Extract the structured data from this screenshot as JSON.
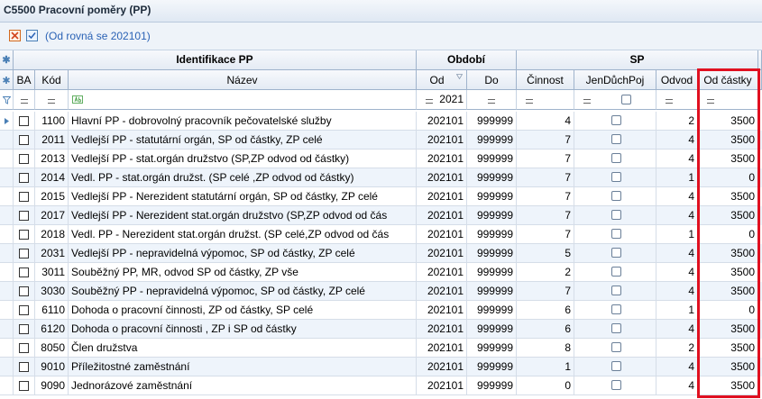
{
  "window": {
    "title": "C5500 Pracovní poměry (PP)"
  },
  "filter": {
    "text": "(Od rovná se 202101)"
  },
  "groups": {
    "ident": "Identifikace PP",
    "period": "Období",
    "sp": "SP"
  },
  "columns": {
    "ba": "BA",
    "kod": "Kód",
    "nazev": "Název",
    "od": "Od",
    "do": "Do",
    "cinnost": "Činnost",
    "jendp": "JenDůchPoj",
    "odvod": "Odvod",
    "odcastky": "Od částky"
  },
  "filter_row": {
    "od_value": "2021"
  },
  "rows": [
    {
      "kod": "1100",
      "nazev": "Hlavní PP - dobrovolný pracovník pečovatelské služby",
      "od": "202101",
      "do": "999999",
      "cinnost": "4",
      "odvod": "2",
      "odcastky": "3500"
    },
    {
      "kod": "2011",
      "nazev": "Vedlejší PP - statutární orgán, SP od částky, ZP celé",
      "od": "202101",
      "do": "999999",
      "cinnost": "7",
      "odvod": "4",
      "odcastky": "3500"
    },
    {
      "kod": "2013",
      "nazev": "Vedlejší PP - stat.orgán družstvo (SP,ZP  odvod od částky)",
      "od": "202101",
      "do": "999999",
      "cinnost": "7",
      "odvod": "4",
      "odcastky": "3500"
    },
    {
      "kod": "2014",
      "nazev": "Vedl. PP - stat.orgán družst. (SP celé ,ZP  odvod od částky)",
      "od": "202101",
      "do": "999999",
      "cinnost": "7",
      "odvod": "1",
      "odcastky": "0"
    },
    {
      "kod": "2015",
      "nazev": "Vedlejší PP - Nerezident statutární orgán, SP od částky, ZP celé",
      "od": "202101",
      "do": "999999",
      "cinnost": "7",
      "odvod": "4",
      "odcastky": "3500"
    },
    {
      "kod": "2017",
      "nazev": "Vedlejší PP - Nerezident stat.orgán družstvo (SP,ZP  odvod od čás",
      "od": "202101",
      "do": "999999",
      "cinnost": "7",
      "odvod": "4",
      "odcastky": "3500"
    },
    {
      "kod": "2018",
      "nazev": "Vedl. PP - Nerezident stat.orgán družst. (SP celé,ZP  odvod od čás",
      "od": "202101",
      "do": "999999",
      "cinnost": "7",
      "odvod": "1",
      "odcastky": "0"
    },
    {
      "kod": "2031",
      "nazev": "Vedlejší PP - nepravidelná výpomoc, SP od částky, ZP celé",
      "od": "202101",
      "do": "999999",
      "cinnost": "5",
      "odvod": "4",
      "odcastky": "3500"
    },
    {
      "kod": "3011",
      "nazev": "Souběžný PP, MR, odvod SP od částky, ZP vše",
      "od": "202101",
      "do": "999999",
      "cinnost": "2",
      "odvod": "4",
      "odcastky": "3500"
    },
    {
      "kod": "3030",
      "nazev": "Souběžný PP - nepravidelná výpomoc, SP od částky, ZP celé",
      "od": "202101",
      "do": "999999",
      "cinnost": "7",
      "odvod": "4",
      "odcastky": "3500"
    },
    {
      "kod": "6110",
      "nazev": "Dohoda o pracovní činnosti, ZP od částky, SP celé",
      "od": "202101",
      "do": "999999",
      "cinnost": "6",
      "odvod": "1",
      "odcastky": "0"
    },
    {
      "kod": "6120",
      "nazev": "Dohoda o pracovní činnosti , ZP i SP od částky",
      "od": "202101",
      "do": "999999",
      "cinnost": "6",
      "odvod": "4",
      "odcastky": "3500"
    },
    {
      "kod": "8050",
      "nazev": "Člen družstva",
      "od": "202101",
      "do": "999999",
      "cinnost": "8",
      "odvod": "2",
      "odcastky": "3500"
    },
    {
      "kod": "9010",
      "nazev": "Příležitostné zaměstnání",
      "od": "202101",
      "do": "999999",
      "cinnost": "1",
      "odvod": "4",
      "odcastky": "3500"
    },
    {
      "kod": "9090",
      "nazev": "Jednorázové zaměstnání",
      "od": "202101",
      "do": "999999",
      "cinnost": "0",
      "odvod": "4",
      "odcastky": "3500"
    }
  ]
}
